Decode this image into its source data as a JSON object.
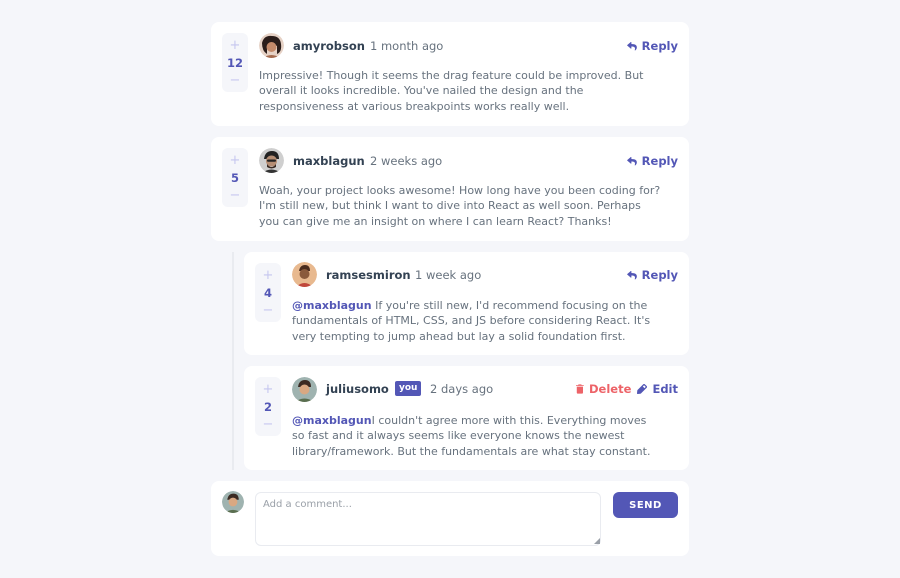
{
  "comments": [
    {
      "username": "amyrobson",
      "time": "1 month ago",
      "score": "12",
      "vote_plus": "+",
      "vote_minus": "−",
      "action": "Reply",
      "content": "Impressive! Though it seems the drag feature could be improved. But overall it looks incredible. You've nailed the design and the responsiveness at various breakpoints works really well."
    },
    {
      "username": "maxblagun",
      "time": "2 weeks ago",
      "score": "5",
      "vote_plus": "+",
      "vote_minus": "−",
      "action": "Reply",
      "content": "Woah, your project looks awesome! How long have you been coding for? I'm still new, but think I want to dive into React as well soon. Perhaps you can give me an insight on where I can learn React? Thanks!"
    }
  ],
  "replies": [
    {
      "username": "ramsesmiron",
      "time": "1 week ago",
      "score": "4",
      "vote_plus": "+",
      "vote_minus": "−",
      "action": "Reply",
      "mention": "@maxblagun",
      "content": " If you're still new, I'd recommend focusing on the fundamentals of HTML, CSS, and JS before considering React. It's very tempting to jump ahead but lay a solid foundation first."
    },
    {
      "username": "juliusomo",
      "badge": "you",
      "time": "2 days ago",
      "score": "2",
      "vote_plus": "+",
      "vote_minus": "−",
      "delete_label": "Delete",
      "edit_label": "Edit",
      "mention": "@maxblagun",
      "content": "I couldn't agree more with this. Everything moves so fast and it always seems like everyone knows the newest library/framework. But the fundamentals are what stay constant."
    }
  ],
  "compose": {
    "placeholder": "Add a comment...",
    "value": "",
    "send_label": "SEND"
  },
  "colors": {
    "primary": "#5357b6",
    "danger": "#ed6368",
    "heading": "#334253",
    "body": "#67727e",
    "background": "#f5f6fa",
    "vote_light": "#c5c6ef"
  }
}
